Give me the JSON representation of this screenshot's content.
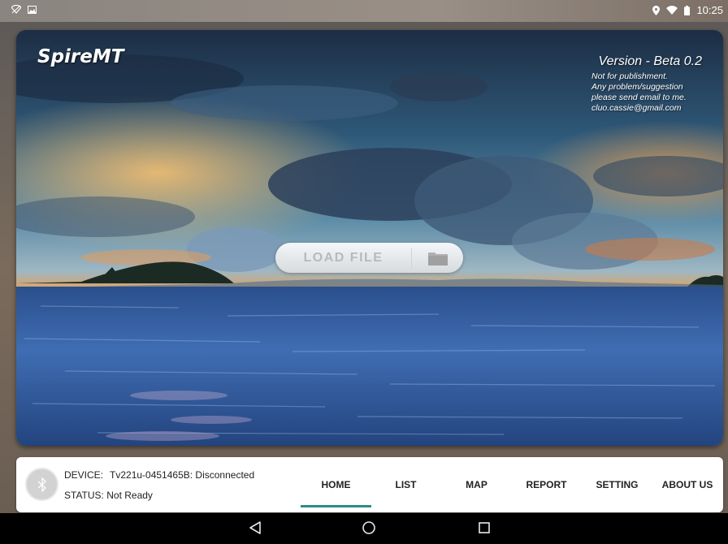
{
  "status_bar": {
    "time": "10:25",
    "icons": [
      "wifi-off-icon",
      "photo-icon",
      "location-icon",
      "wifi-icon",
      "battery-icon"
    ]
  },
  "hero": {
    "app_title": "SpireMT",
    "version_title": "Version - Beta 0.2",
    "notes": [
      "Not for publishment.",
      "Any problem/suggestion",
      "please send email to me.",
      "cluo.cassie@gmail.com"
    ],
    "load_button": "LOAD FILE",
    "folder_icon": "folder-icon"
  },
  "device": {
    "device_label": "DEVICE:",
    "device_value": "Tv221u-0451465B: Disconnected",
    "status_text": "STATUS: Not Ready",
    "bluetooth_icon": "bluetooth-icon"
  },
  "nav": {
    "tabs": [
      "HOME",
      "LIST",
      "MAP",
      "REPORT",
      "SETTING",
      "ABOUT US"
    ],
    "active": "HOME",
    "accent": "#2e8b8b"
  },
  "system_nav": {
    "icons": [
      "back-icon",
      "home-icon",
      "recents-icon"
    ]
  }
}
